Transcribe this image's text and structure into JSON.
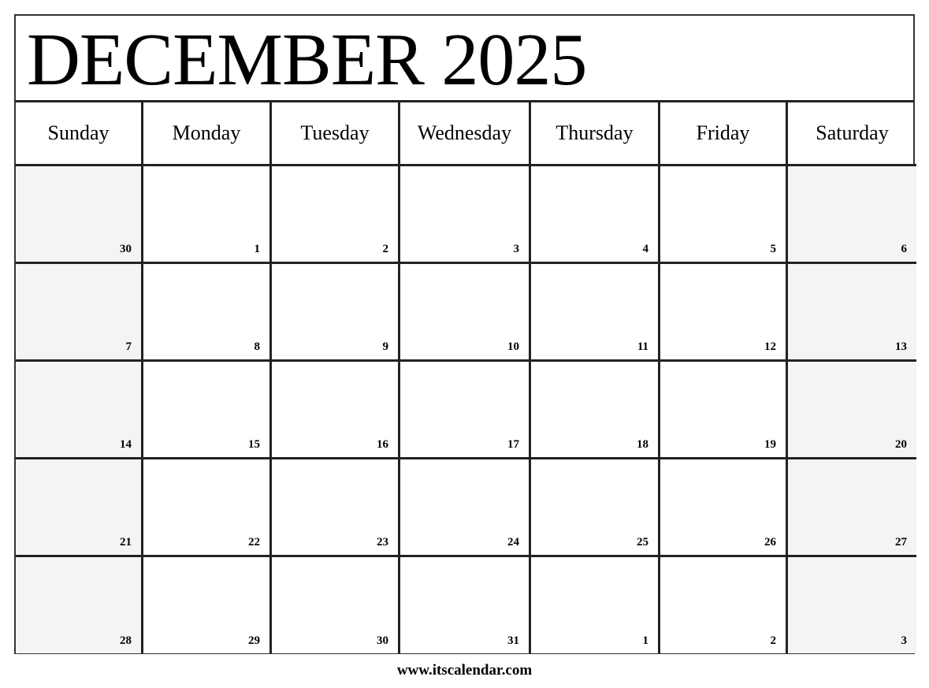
{
  "title": "DECEMBER 2025",
  "weekdays": [
    "Sunday",
    "Monday",
    "Tuesday",
    "Wednesday",
    "Thursday",
    "Friday",
    "Saturday"
  ],
  "weeks": [
    [
      {
        "day": "30",
        "weekend": true,
        "other_month": true
      },
      {
        "day": "1"
      },
      {
        "day": "2"
      },
      {
        "day": "3"
      },
      {
        "day": "4"
      },
      {
        "day": "5"
      },
      {
        "day": "6",
        "weekend": true
      }
    ],
    [
      {
        "day": "7",
        "weekend": true
      },
      {
        "day": "8"
      },
      {
        "day": "9"
      },
      {
        "day": "10"
      },
      {
        "day": "11"
      },
      {
        "day": "12"
      },
      {
        "day": "13",
        "weekend": true
      }
    ],
    [
      {
        "day": "14",
        "weekend": true
      },
      {
        "day": "15"
      },
      {
        "day": "16"
      },
      {
        "day": "17"
      },
      {
        "day": "18"
      },
      {
        "day": "19"
      },
      {
        "day": "20",
        "weekend": true
      }
    ],
    [
      {
        "day": "21",
        "weekend": true
      },
      {
        "day": "22"
      },
      {
        "day": "23"
      },
      {
        "day": "24"
      },
      {
        "day": "25"
      },
      {
        "day": "26"
      },
      {
        "day": "27",
        "weekend": true
      }
    ],
    [
      {
        "day": "28",
        "weekend": true
      },
      {
        "day": "29"
      },
      {
        "day": "30"
      },
      {
        "day": "31"
      },
      {
        "day": "1",
        "other_month": true
      },
      {
        "day": "2",
        "other_month": true
      },
      {
        "day": "3",
        "weekend": true,
        "other_month": true
      }
    ]
  ],
  "footer": "www.itscalendar.com",
  "colors": {
    "weekend_fill": "#f4f4f4",
    "border": "#222222"
  }
}
